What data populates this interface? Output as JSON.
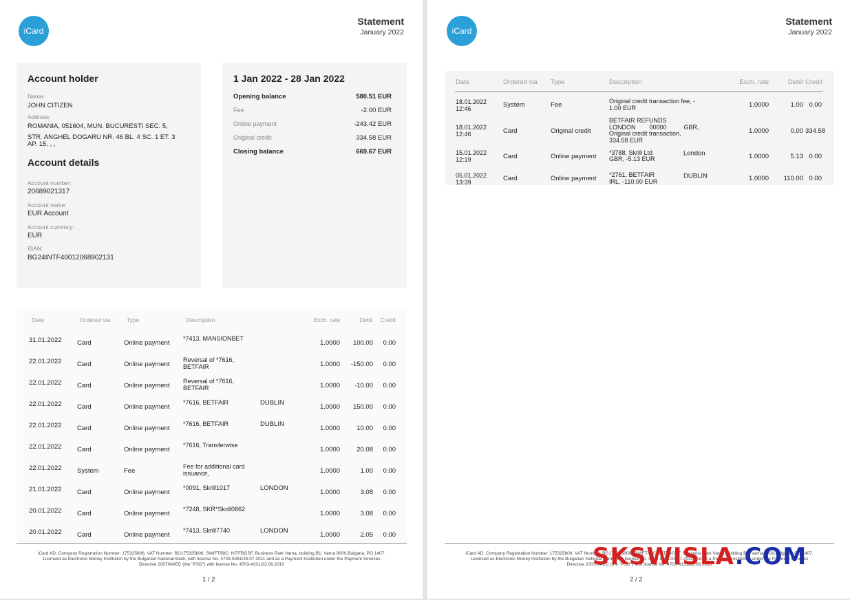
{
  "brand": {
    "logo_text": "iCard",
    "logo_color": "#2a9fd8"
  },
  "header": {
    "title": "Statement",
    "month": "January 2022"
  },
  "account_holder": {
    "heading": "Account holder",
    "name_label": "Name:",
    "name": "JOHN CITIZEN",
    "address_label": "Address:",
    "address_line1": "ROMANIA, 051604, MUN. BUCURESTI SEC. 5,",
    "address_line2": "STR. ANGHEL DOGARU NR. 46 BL. 4 SC. 1 ET. 3",
    "address_line3": "AP. 15, , ,"
  },
  "account_details": {
    "heading": "Account details",
    "number_label": "Account number:",
    "number": "20689021317",
    "name_label": "Account name:",
    "name": "EUR Account",
    "currency_label": "Account currency:",
    "currency": "EUR",
    "iban_label": "IBAN:",
    "iban": "BG24INTF40012068902131"
  },
  "summary": {
    "period": "1 Jan 2022 - 28 Jan 2022",
    "rows": [
      {
        "label": "Opening balance",
        "value": "580.51 EUR"
      },
      {
        "label": "Fee",
        "value": "-2.00 EUR"
      },
      {
        "label": "Online payment",
        "value": "-243.42 EUR"
      },
      {
        "label": "Original credit",
        "value": "334.58 EUR"
      },
      {
        "label": "Closing balance",
        "value": "669.67 EUR"
      }
    ]
  },
  "table_headers": {
    "date": "Date",
    "ordered_via": "Ordered via",
    "type": "Type",
    "description": "Description",
    "exch_rate": "Exch. rate",
    "debit": "Debit",
    "credit": "Credit"
  },
  "page1_rows": [
    {
      "date": "31.01.2022",
      "via": "Card",
      "type": "Online payment",
      "desc": "*7413, MANSIONBET",
      "city": "",
      "rate": "1.0000",
      "debit": "100.00",
      "credit": "0.00"
    },
    {
      "date": "22.01.2022",
      "via": "Card",
      "type": "Online payment",
      "desc": "Reversal of *7616, BETFAIR",
      "city": "",
      "rate": "1.0000",
      "debit": "-150.00",
      "credit": "0.00"
    },
    {
      "date": "22.01.2022",
      "via": "Card",
      "type": "Online payment",
      "desc": "Reversal of *7616, BETFAIR",
      "city": "",
      "rate": "1.0000",
      "debit": "-10.00",
      "credit": "0.00"
    },
    {
      "date": "22.01.2022",
      "via": "Card",
      "type": "Online payment",
      "desc": "*7616, BETFAIR",
      "city": "DUBLIN",
      "rate": "1.0000",
      "debit": "150.00",
      "credit": "0.00"
    },
    {
      "date": "22.01.2022",
      "via": "Card",
      "type": "Online payment",
      "desc": "*7616, BETFAIR",
      "city": "DUBLIN",
      "rate": "1.0000",
      "debit": "10.00",
      "credit": "0.00"
    },
    {
      "date": "22.01.2022",
      "via": "Card",
      "type": "Online payment",
      "desc": "*7616, Transferwise",
      "city": "",
      "rate": "1.0000",
      "debit": "20.08",
      "credit": "0.00"
    },
    {
      "date": "22.01.2022",
      "via": "System",
      "type": "Fee",
      "desc": "Fee for additional card issuance,",
      "city": "",
      "rate": "1.0000",
      "debit": "1.00",
      "credit": "0.00"
    },
    {
      "date": "21.01.2022",
      "via": "Card",
      "type": "Online payment",
      "desc": "*0091, Skrill1017",
      "city": "LONDON",
      "rate": "1.0000",
      "debit": "3.08",
      "credit": "0.00"
    },
    {
      "date": "20.01.2022",
      "via": "Card",
      "type": "Online payment",
      "desc": "*7248, SKR*Skrill0862",
      "city": "",
      "rate": "1.0000",
      "debit": "3.08",
      "credit": "0.00"
    },
    {
      "date": "20.01.2022",
      "via": "Card",
      "type": "Online payment",
      "desc": "*7413, Skrill7740",
      "city": "LONDON",
      "rate": "1.0000",
      "debit": "2.05",
      "credit": "0.00"
    }
  ],
  "page2_rows": [
    {
      "date": "18.01.2022",
      "time": "12:46",
      "via": "System",
      "type": "Fee",
      "desc1": "Original credit transaction fee, -",
      "desc2": "1.00 EUR",
      "desc3": "",
      "desc4": "",
      "city": "",
      "rate": "1.0000",
      "debit": "1.00",
      "credit": "0.00"
    },
    {
      "date": "18.01.2022",
      "time": "12:46",
      "via": "Card",
      "type": "Original credit",
      "desc1": "BETFAIR REFUNDS",
      "desc2": "LONDON        00000          GBR,",
      "desc3": "Original credit transaction,",
      "desc4": "334.58 EUR",
      "city": "",
      "rate": "1.0000",
      "debit": "0.00",
      "credit": "334.58"
    },
    {
      "date": "15.01.2022",
      "time": "12:19",
      "via": "Card",
      "type": "Online payment",
      "desc1": "*3788, Skrill Ltd",
      "desc2": "GBR, -5.13 EUR",
      "desc3": "",
      "desc4": "",
      "city": "London",
      "rate": "1.0000",
      "debit": "5.13",
      "credit": "0.00"
    },
    {
      "date": "05.01.2022",
      "time": "13:39",
      "via": "Card",
      "type": "Online payment",
      "desc1": "*2761, BETFAIR",
      "desc2": "IRL, -110.00 EUR",
      "desc3": "",
      "desc4": "",
      "city": "DUBLIN",
      "rate": "1.0000",
      "debit": "110.00",
      "credit": "0.00"
    }
  ],
  "footer": {
    "line1": "iCard AD, Company Registration Number: 175325806, VAT Number: BG175325806, SWIFT/BIC: INTFBGSF, Business Park Varna, building B1, Varna 9009,Bulgaria, PO 1407.",
    "line2": "Licensed as Electronic Money Institution by the Bulgarian National Bank, with license No. 4703-5081/25.07.2011 and as a Payment Institution under the Payment Services",
    "line3": "Directive 2007/64/EC (the \"PSD\") with license No. 4703-4331/23.06.2010",
    "page1": "1 / 2",
    "page2": "2 / 2"
  },
  "watermark": {
    "part1": "SKSWISLA",
    "part2": ".COM",
    "color1": "#d42020",
    "color2": "#1a2ea8"
  }
}
